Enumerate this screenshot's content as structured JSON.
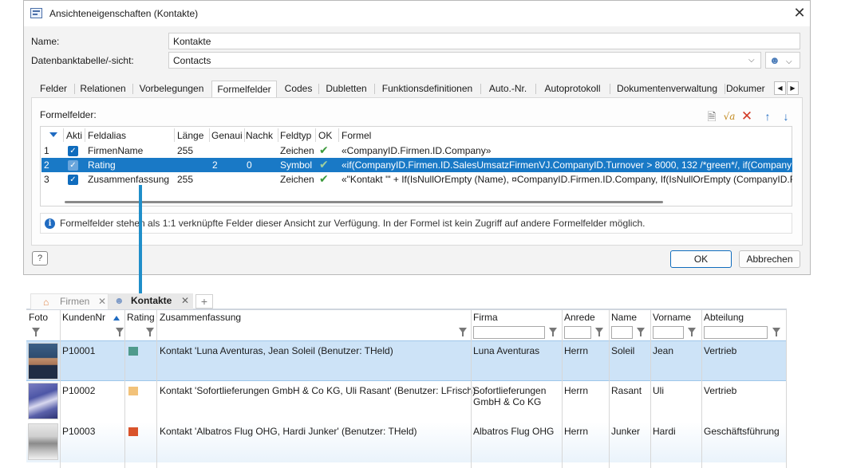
{
  "dialog": {
    "title": "Ansichteneigenschaften (Kontakte)",
    "name_label": "Name:",
    "name_value": "Kontakte",
    "db_label": "Datenbanktabelle/-sicht:",
    "db_value": "Contacts",
    "tabs": [
      "Felder",
      "Relationen",
      "Vorbelegungen",
      "Formelfelder",
      "Codes",
      "Dubletten",
      "Funktionsdefinitionen",
      "Auto.-Nr.",
      "Autoprotokoll",
      "Dokumentenverwaltung",
      "Dokumer"
    ],
    "selected_tab": "Formelfelder",
    "formelfelder_label": "Formelfelder:",
    "grid": {
      "headers": [
        "Akti",
        "Feldalias",
        "Länge",
        "Genaui",
        "Nachk",
        "Feldtyp",
        "OK",
        "Formel"
      ],
      "rows": [
        {
          "num": "1",
          "alias": "FirmenName",
          "laenge": "255",
          "genau": "",
          "nachk": "",
          "typ": "Zeichen",
          "formel": "«CompanyID.Firmen.ID.Company»"
        },
        {
          "num": "2",
          "alias": "Rating",
          "laenge": "",
          "genau": "2",
          "nachk": "0",
          "typ": "Symbol",
          "formel": "«if(CompanyID.Firmen.ID.SalesUmsatzFirmenVJ.CompanyID.Turnover > 8000, 132 /*green*/, if(Company"
        },
        {
          "num": "3",
          "alias": "Zusammenfassung",
          "laenge": "255",
          "genau": "",
          "nachk": "",
          "typ": "Zeichen",
          "formel": "«\"Kontakt '\" + If(IsNullOrEmpty (Name), ¤CompanyID.Firmen.ID.Company, If(IsNullOrEmpty (CompanyID.F"
        }
      ]
    },
    "info_text": "Formelfelder stehen als 1:1 verknüpfte Felder dieser Ansicht zur Verfügung. In der Formel ist kein Zugriff auf andere Formelfelder möglich.",
    "ok_label": "OK",
    "cancel_label": "Abbrechen",
    "help_icon": "help-icon"
  },
  "table": {
    "tabs": {
      "firmen": "Firmen",
      "kontakte": "Kontakte",
      "plus": "+"
    },
    "headers": [
      "Foto",
      "KundenNr",
      "Rating",
      "Zusammenfassung",
      "Firma",
      "Anrede",
      "Name",
      "Vorname",
      "Abteilung"
    ],
    "rows": [
      {
        "kundennr": "P10001",
        "rating_color": "#4f9a8c",
        "zusammenfassung": "Kontakt 'Luna Aventuras, Jean Soleil (Benutzer: THeld)",
        "firma": "Luna Aventuras",
        "firma2": "",
        "anrede": "Herrn",
        "name": "Soleil",
        "vorname": "Jean",
        "abteilung": "Vertrieb"
      },
      {
        "kundennr": "P10002",
        "rating_color": "#f2c27a",
        "zusammenfassung": "Kontakt 'Sofortlieferungen GmbH & Co KG, Uli Rasant' (Benutzer: LFrisch)",
        "firma": "Sofortlieferungen",
        "firma2": "GmbH & Co KG",
        "anrede": "Herrn",
        "name": "Rasant",
        "vorname": "Uli",
        "abteilung": "Vertrieb"
      },
      {
        "kundennr": "P10003",
        "rating_color": "#d9532b",
        "zusammenfassung": "Kontakt 'Albatros Flug OHG, Hardi Junker' (Benutzer: THeld)",
        "firma": "Albatros Flug OHG",
        "firma2": "",
        "anrede": "Herrn",
        "name": "Junker",
        "vorname": "Hardi",
        "abteilung": "Geschäftsführung"
      }
    ]
  },
  "colors": {
    "selection": "#1979c6",
    "row_selected": "#cfe3f6",
    "arrow": "#1f8ec9",
    "accent": "#0f6cbd"
  }
}
